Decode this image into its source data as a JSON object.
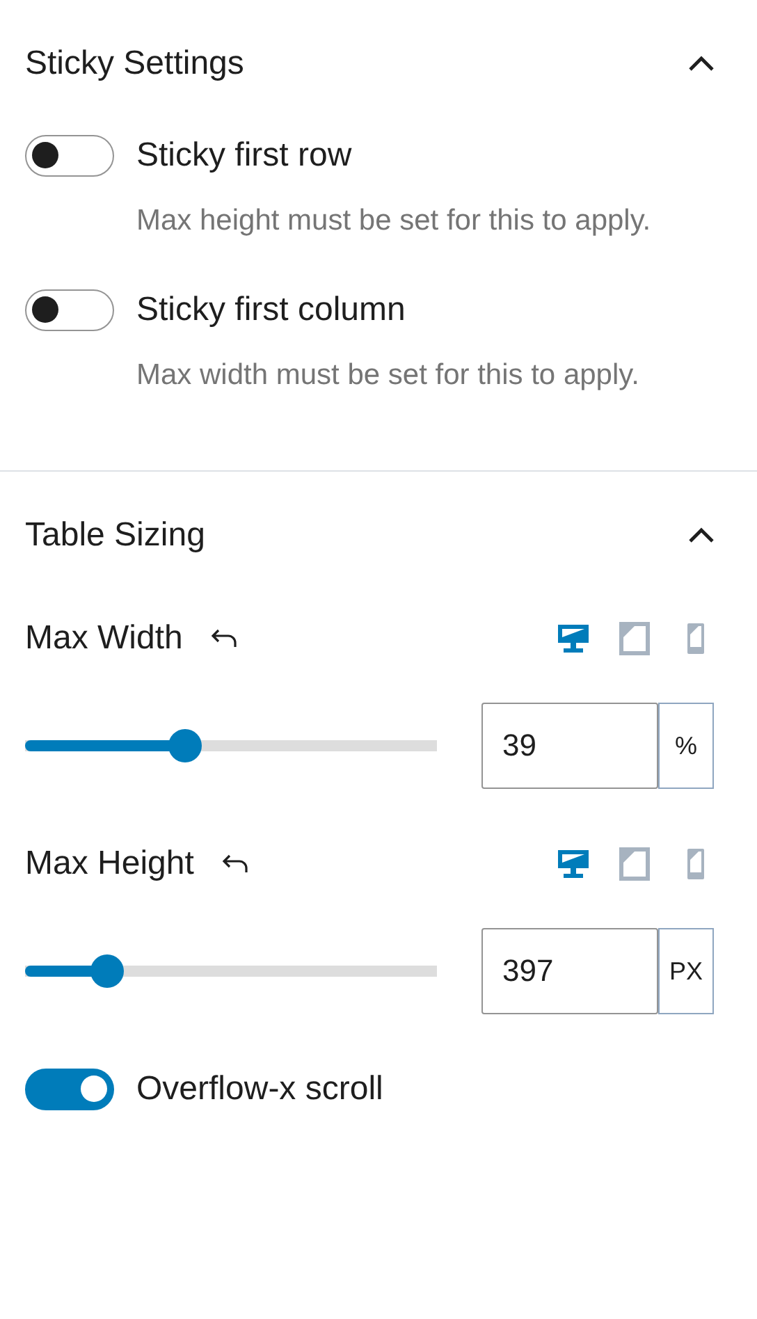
{
  "sections": [
    {
      "title": "Sticky Settings",
      "expanded": true,
      "controls": [
        {
          "kind": "toggle",
          "label": "Sticky first row",
          "on": false,
          "help": "Max height must be set for this to apply."
        },
        {
          "kind": "toggle",
          "label": "Sticky first column",
          "on": false,
          "help": "Max width must be set for this to apply."
        }
      ]
    },
    {
      "title": "Table Sizing",
      "expanded": true,
      "controls": [
        {
          "kind": "range",
          "label": "Max Width",
          "devices": [
            {
              "kind": "desktop",
              "selected": true
            },
            {
              "kind": "tablet",
              "selected": false
            },
            {
              "kind": "mobile",
              "selected": false
            }
          ],
          "level": 0.39,
          "value": "39",
          "unit": "%"
        },
        {
          "kind": "range",
          "label": "Max Height",
          "devices": [
            {
              "kind": "desktop",
              "selected": true
            },
            {
              "kind": "tablet",
              "selected": false
            },
            {
              "kind": "mobile",
              "selected": false
            }
          ],
          "level": 0.2,
          "value": "397",
          "unit": "PX"
        },
        {
          "kind": "toggle",
          "label": "Overflow-x scroll",
          "on": true
        }
      ]
    }
  ]
}
